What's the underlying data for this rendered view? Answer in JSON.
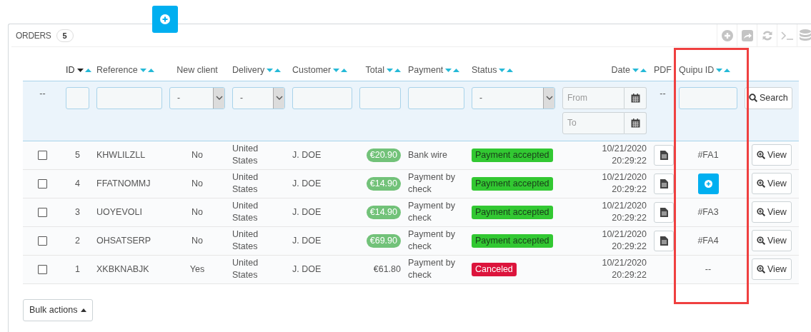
{
  "panel": {
    "title": "ORDERS",
    "count": "5"
  },
  "columns": [
    {},
    {
      "label": "ID",
      "sortable": true,
      "sorted_desc": true
    },
    {
      "label": "Reference",
      "sortable": true,
      "sorted_desc": false
    },
    {
      "label": "New client",
      "sortable": false
    },
    {
      "label": "Delivery",
      "sortable": true,
      "sorted_desc": false
    },
    {
      "label": "Customer",
      "sortable": true,
      "sorted_desc": false
    },
    {
      "label": "Total",
      "sortable": true,
      "sorted_desc": false
    },
    {
      "label": "Payment",
      "sortable": true,
      "sorted_desc": false
    },
    {
      "label": "Status",
      "sortable": true,
      "sorted_desc": false
    },
    {
      "label": "Date",
      "sortable": true,
      "sorted_desc": false
    },
    {
      "label": "PDF",
      "sortable": false
    },
    {
      "label": "Quipu ID",
      "sortable": true,
      "sorted_desc": false
    },
    {}
  ],
  "filters": [
    {
      "kind": "dash",
      "text": "--"
    },
    {
      "kind": "text"
    },
    {
      "kind": "text"
    },
    {
      "kind": "select",
      "value": "-"
    },
    {
      "kind": "select",
      "value": "-"
    },
    {
      "kind": "text"
    },
    {
      "kind": "text"
    },
    {
      "kind": "text"
    },
    {
      "kind": "select",
      "value": "-"
    },
    {
      "kind": "daterange",
      "from_placeholder": "From",
      "to_placeholder": "To"
    },
    {
      "kind": "dash",
      "text": "--"
    },
    {
      "kind": "text"
    },
    {
      "kind": "button",
      "label": "Search"
    }
  ],
  "rows": [
    {
      "checked": false,
      "id": "5",
      "reference": "KHWLILZLL",
      "new_client": "No",
      "delivery": "United States",
      "customer": "J. DOE",
      "total": "€20.90",
      "total_badge": true,
      "payment": "Bank wire",
      "status": {
        "text": "Payment accepted",
        "color": "#32c832"
      },
      "date": "10/21/2020 20:29:22",
      "pdf": true,
      "quipu": {
        "kind": "text",
        "text": "#FA1"
      },
      "action": "View"
    },
    {
      "checked": false,
      "id": "4",
      "reference": "FFATNOMMJ",
      "new_client": "No",
      "delivery": "United States",
      "customer": "J. DOE",
      "total": "€14.90",
      "total_badge": true,
      "payment": "Payment by check",
      "status": {
        "text": "Payment accepted",
        "color": "#32c832"
      },
      "date": "10/21/2020 20:29:22",
      "pdf": true,
      "quipu": {
        "kind": "button"
      },
      "action": "View"
    },
    {
      "checked": false,
      "id": "3",
      "reference": "UOYEVOLI",
      "new_client": "No",
      "delivery": "United States",
      "customer": "J. DOE",
      "total": "€14.90",
      "total_badge": true,
      "payment": "Payment by check",
      "status": {
        "text": "Payment accepted",
        "color": "#32c832"
      },
      "date": "10/21/2020 20:29:22",
      "pdf": true,
      "quipu": {
        "kind": "text",
        "text": "#FA3"
      },
      "action": "View"
    },
    {
      "checked": false,
      "id": "2",
      "reference": "OHSATSERP",
      "new_client": "No",
      "delivery": "United States",
      "customer": "J. DOE",
      "total": "€69.90",
      "total_badge": true,
      "payment": "Payment by check",
      "status": {
        "text": "Payment accepted",
        "color": "#32c832"
      },
      "date": "10/21/2020 20:29:22",
      "pdf": true,
      "quipu": {
        "kind": "text",
        "text": "#FA4"
      },
      "action": "View"
    },
    {
      "checked": false,
      "id": "1",
      "reference": "XKBKNABJK",
      "new_client": "Yes",
      "delivery": "United States",
      "customer": "J. DOE",
      "total": "€61.80",
      "total_badge": false,
      "payment": "Payment by check",
      "status": {
        "text": "Canceled",
        "color": "#dc143c"
      },
      "date": "10/21/2020 20:29:22",
      "pdf": false,
      "quipu": {
        "kind": "text",
        "text": "--"
      },
      "action": "View"
    }
  ],
  "bulk_actions": "Bulk actions"
}
